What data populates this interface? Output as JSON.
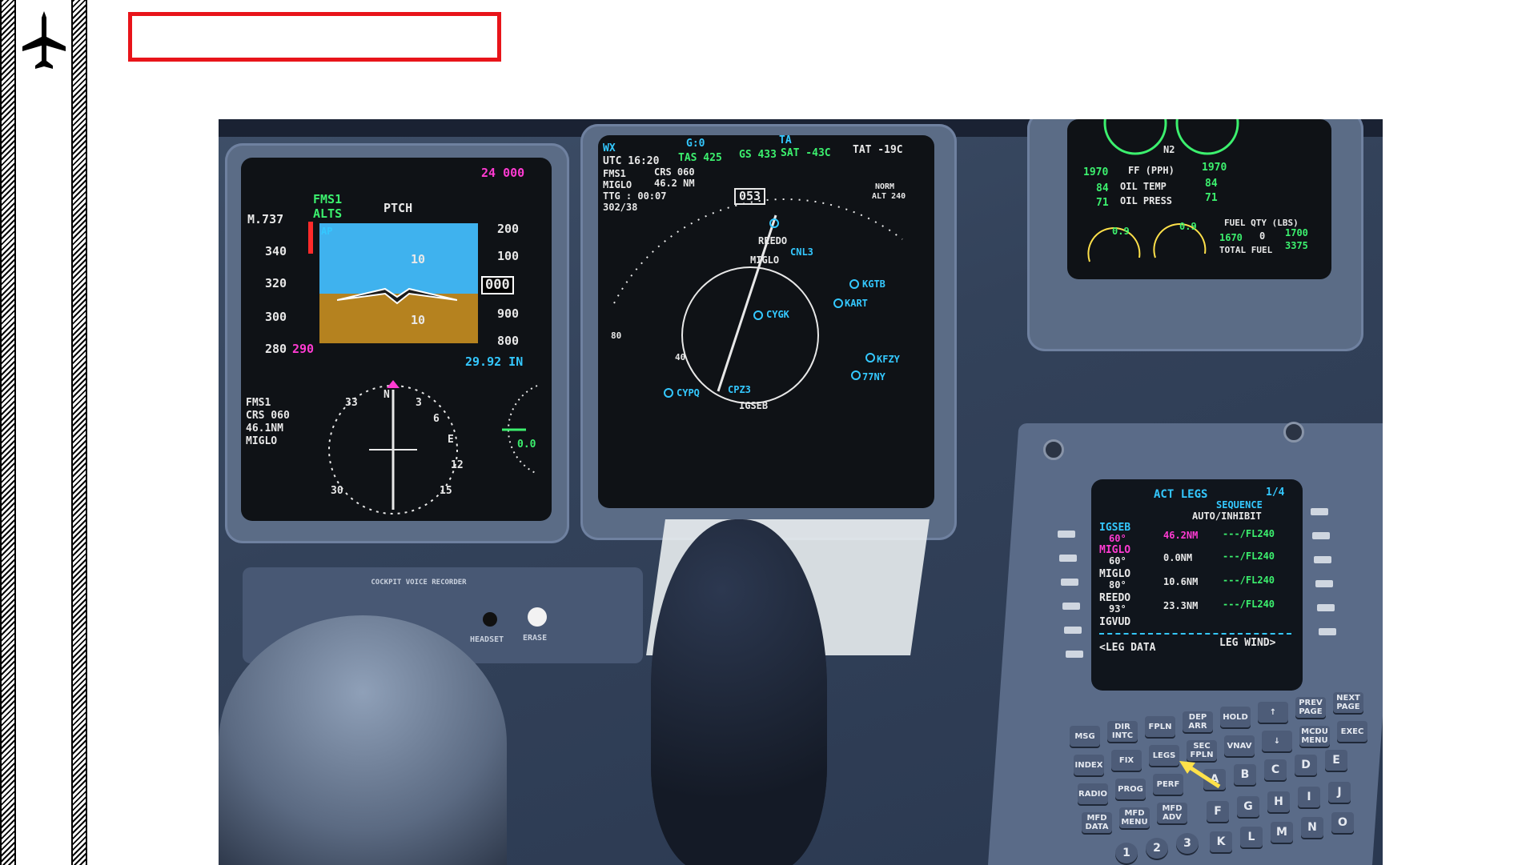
{
  "sidebar": {
    "icon": "airplane-icon"
  },
  "title_box": {
    "text": ""
  },
  "pfd": {
    "selected_alt": "24 000",
    "mach": "M.737",
    "fma_lat": "FMS1",
    "fma_vert": "ALTS",
    "fma_pitch": "PTCH",
    "ap": "AP",
    "speeds": [
      "340",
      "320",
      "300",
      "280"
    ],
    "speed_bug": "290",
    "alts": [
      "200",
      "100",
      "24 000",
      "900",
      "800"
    ],
    "alt_current": "000",
    "baro": "29.92 IN",
    "pitch_up": "10",
    "pitch_down": "10",
    "nav_src": "FMS1",
    "nav_crs": "CRS 060",
    "nav_dist": "46.1NM",
    "nav_wpt": "MIGLO",
    "vs": "0.0",
    "hsi_marks": [
      "33",
      "N",
      "3",
      "6",
      "E",
      "12",
      "15",
      "30"
    ]
  },
  "mfd": {
    "wx": "WX",
    "g": "G:0",
    "ta": "TA",
    "utc": "UTC 16:20",
    "tas": "TAS 425",
    "gs": "GS 433",
    "sat": "SAT -43C",
    "tat": "TAT -19C",
    "src": "FMS1",
    "crs": "CRS 060",
    "wpt": "MIGLO",
    "dist": "46.2 NM",
    "ttg": "TTG : 00:07",
    "wind": "302/38",
    "heading": "053",
    "norm": "NORM",
    "alt": "ALT 240",
    "ranges": [
      "80",
      "40"
    ],
    "waypoints": [
      "REEDO",
      "MIGLO",
      "IGSEB"
    ],
    "airports": [
      "KGTB",
      "KART",
      "CYGK",
      "CYPQ",
      "77NY",
      "KFZY",
      "CNL3",
      "CPZ3"
    ]
  },
  "eicas": {
    "n2": "N2",
    "ff_left": "1970",
    "ff_label": "FF (PPH)",
    "ff_right": "1970",
    "oil_temp_left": "84",
    "oil_temp_label": "OIL TEMP",
    "oil_temp_right": "84",
    "oil_press_left": "71",
    "oil_press_label": "OIL PRESS",
    "oil_press_right": "71",
    "vib_left": "0.9",
    "vib_right": "0.9",
    "fuel_qty": "FUEL QTY (LBS)",
    "fuel_left": "1670",
    "fuel_center": "0",
    "fuel_right": "1700",
    "total_fuel_label": "TOTAL FUEL",
    "total_fuel": "3375"
  },
  "cdu": {
    "title": "ACT LEGS",
    "page": "1/4",
    "sequence": "SEQUENCE",
    "auto_inhibit": "AUTO/INHIBIT",
    "legs": [
      {
        "name": "IGSEB",
        "course": "60°",
        "dist": "46.2NM",
        "alt": "---/FL240"
      },
      {
        "name": "MIGLO",
        "course": "60°",
        "dist": "0.0NM",
        "alt": "---/FL240"
      },
      {
        "name": "MIGLO",
        "course": "80°",
        "dist": "10.6NM",
        "alt": "---/FL240"
      },
      {
        "name": "REEDO",
        "course": "93°",
        "dist": "23.3NM",
        "alt": "---/FL240"
      },
      {
        "name": "IGVUD",
        "course": "",
        "dist": "",
        "alt": ""
      }
    ],
    "leg_data": "<LEG DATA",
    "leg_wind": "LEG WIND>",
    "keys": {
      "row1": [
        "MSG",
        "DIR INTC",
        "FPLN",
        "DEP ARR",
        "HOLD",
        "↑",
        "PREV PAGE",
        "NEXT PAGE"
      ],
      "row2": [
        "INDEX",
        "FIX",
        "LEGS",
        "SEC FPLN",
        "VNAV",
        "↓",
        "MCDU MENU",
        "EXEC"
      ],
      "row3": [
        "RADIO",
        "PROG",
        "PERF"
      ],
      "row4": [
        "MFD DATA",
        "MFD MENU",
        "MFD ADV"
      ],
      "letters": [
        "A",
        "B",
        "C",
        "D",
        "E",
        "F",
        "G",
        "H",
        "I",
        "J",
        "K",
        "L",
        "M",
        "N",
        "O"
      ],
      "numbers": [
        "1",
        "2",
        "3"
      ]
    }
  },
  "panel": {
    "cvr": "COCKPIT VOICE RECORDER",
    "headset": "HEADSET",
    "erase": "ERASE"
  },
  "colors": {
    "highlight_box": "#e8141a",
    "arrow": "#ffe14a",
    "fms_green": "#3cf06e",
    "magenta": "#ff3bd2",
    "cyan": "#34c8ff"
  }
}
